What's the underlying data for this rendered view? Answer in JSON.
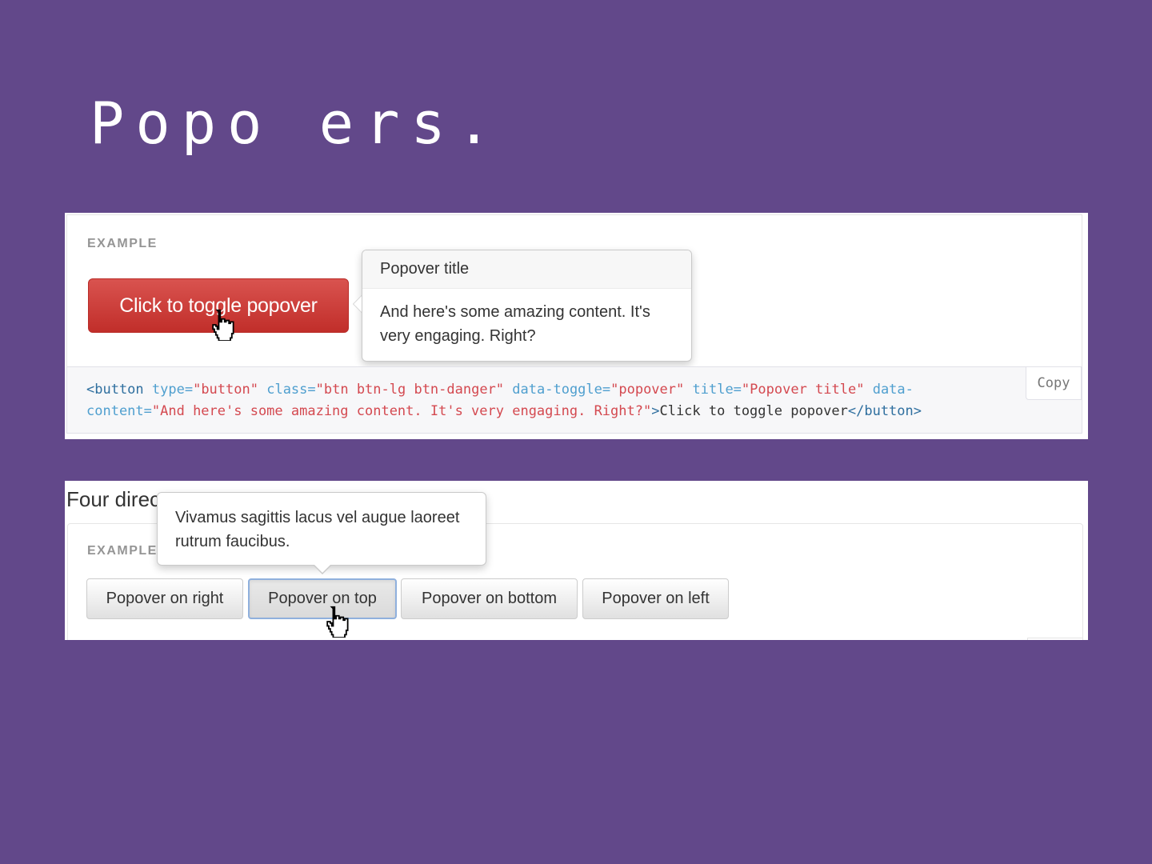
{
  "slide": {
    "title": "Popo ers."
  },
  "example1": {
    "label": "EXAMPLE",
    "button_label": "Click to toggle popover",
    "popover": {
      "title": "Popover title",
      "content": "And here's some amazing content. It's very engaging. Right?"
    },
    "code": {
      "line1": [
        {
          "t": "<button ",
          "c": "tag"
        },
        {
          "t": "type=",
          "c": "attr"
        },
        {
          "t": "\"button\"",
          "c": "val"
        },
        {
          "t": " ",
          "c": "text"
        },
        {
          "t": "class=",
          "c": "attr"
        },
        {
          "t": "\"btn btn-lg btn-danger\"",
          "c": "val"
        },
        {
          "t": " ",
          "c": "text"
        },
        {
          "t": "data-toggle=",
          "c": "attr"
        },
        {
          "t": "\"popover\"",
          "c": "val"
        },
        {
          "t": " ",
          "c": "text"
        },
        {
          "t": "title=",
          "c": "attr"
        },
        {
          "t": "\"Popover title\"",
          "c": "val"
        },
        {
          "t": " ",
          "c": "text"
        },
        {
          "t": "data-",
          "c": "attr"
        }
      ],
      "line2": [
        {
          "t": "content=",
          "c": "attr"
        },
        {
          "t": "\"And here's some amazing content. It's very engaging. Right?\"",
          "c": "val"
        },
        {
          "t": ">",
          "c": "tag"
        },
        {
          "t": "Click to toggle popover",
          "c": "text"
        },
        {
          "t": "</button>",
          "c": "tag"
        }
      ]
    },
    "copy_label": "Copy"
  },
  "example2": {
    "heading": "Four direc",
    "label": "EXAMPLE",
    "popover_content": "Vivamus sagittis lacus vel augue laoreet rutrum faucibus.",
    "buttons": [
      {
        "label": "Popover on right"
      },
      {
        "label": "Popover on top"
      },
      {
        "label": "Popover on bottom"
      },
      {
        "label": "Popover on left"
      }
    ]
  },
  "icons": {
    "cursor": "hand-pointer-icon",
    "arrow": "popover-arrow"
  },
  "colors": {
    "background": "#62488a",
    "danger": "#d9534f",
    "code_bg": "#f7f7f9"
  }
}
